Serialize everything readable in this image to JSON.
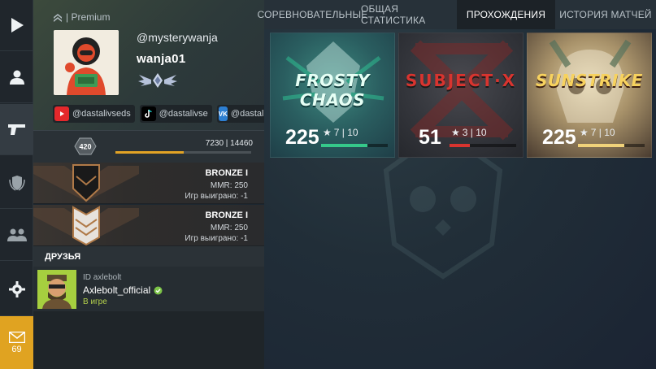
{
  "sidebar": {
    "mail_count": "69"
  },
  "profile": {
    "premium_label": "| Premium",
    "handle": "@mysterywanja",
    "nickname": "wanja01",
    "socials": [
      {
        "icon": "youtube-icon",
        "label": "@dastalivseds",
        "color": "#e4282b"
      },
      {
        "icon": "tiktok-icon",
        "label": "@dastalivse",
        "color": "#000000"
      },
      {
        "icon": "vk-icon",
        "label": "@dastali",
        "color": "#2d7fd2"
      }
    ]
  },
  "level": {
    "value": "420",
    "xp_text": "7230 | 14460",
    "progress": 0.5
  },
  "ranks": [
    {
      "name": "BRONZE I",
      "mmr": "MMR: 250",
      "games": "Игр выиграно: -1",
      "emblem": "dark-chevron"
    },
    {
      "name": "BRONZE I",
      "mmr": "MMR: 250",
      "games": "Игр выиграно: -1",
      "emblem": "light-chevron"
    }
  ],
  "friends": {
    "title": "ДРУЗЬЯ",
    "items": [
      {
        "id_text": "ID axlebolt",
        "name": "Axlebolt_official",
        "status": "В игре"
      }
    ]
  },
  "tabs": [
    {
      "label": "СОРЕВНОВАТЕЛЬНЫЕ",
      "active": false
    },
    {
      "label": "ОБЩАЯ СТАТИСТИКА",
      "active": false
    },
    {
      "label": "ПРОХОЖДЕНИЯ",
      "active": true
    },
    {
      "label": "ИСТОРИЯ МАТЧЕЙ",
      "active": false
    }
  ],
  "missions": [
    {
      "title": "FROSTY CHAOS",
      "score": "225",
      "stars": "7 | 10",
      "progress": 0.7,
      "accent": "#35c98a",
      "title_color": "#e6fff5"
    },
    {
      "title": "SUBJECT·X",
      "score": "51",
      "stars": "3 | 10",
      "progress": 0.3,
      "accent": "#d8342f",
      "title_color": "#d8342f"
    },
    {
      "title": "SUNSTRIKE",
      "score": "225",
      "stars": "7 | 10",
      "progress": 0.7,
      "accent": "#f0d27a",
      "title_color": "#f7d25e"
    }
  ]
}
